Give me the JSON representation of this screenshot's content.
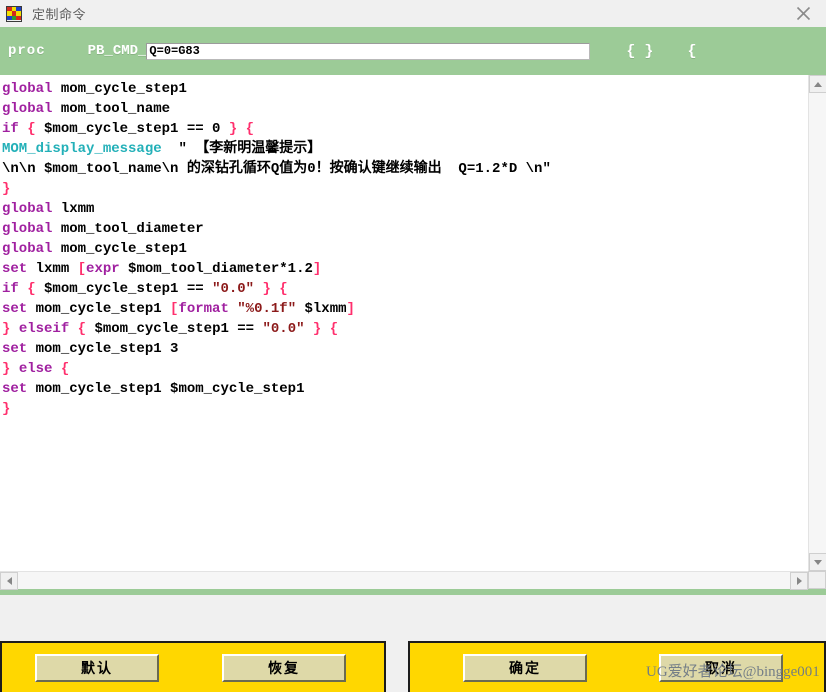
{
  "window": {
    "title": "定制命令",
    "icon": "app-grid-icon",
    "close_label": "×",
    "icon_colors": [
      "#d42a1d",
      "#f2e000",
      "#1f3fc4",
      "#f2e000",
      "#d42a1d",
      "#f2e000",
      "#1f3fc4",
      "#2e9e2e",
      "#d42a1d"
    ]
  },
  "toolbar": {
    "proc_keyword": "proc",
    "name_prefix": "PB_CMD_",
    "proc_name_value": "Q=0=G83",
    "proc_name_placeholder": "",
    "brace_1": "{ }",
    "brace_2": "{",
    "background": "#9ccb97"
  },
  "editor": {
    "lines": [
      [
        {
          "t": "global",
          "c": "kw"
        },
        {
          "t": " mom_cycle_step1",
          "c": "plain"
        }
      ],
      [
        {
          "t": "global",
          "c": "kw"
        },
        {
          "t": " mom_tool_name",
          "c": "plain"
        }
      ],
      [
        {
          "t": "if",
          "c": "kw"
        },
        {
          "t": " ",
          "c": "plain"
        },
        {
          "t": "{",
          "c": "br"
        },
        {
          "t": " $mom_cycle_step1 == 0 ",
          "c": "plain"
        },
        {
          "t": "}",
          "c": "br"
        },
        {
          "t": " ",
          "c": "plain"
        },
        {
          "t": "{",
          "c": "br"
        }
      ],
      [
        {
          "t": "MOM_display_message",
          "c": "cmd"
        },
        {
          "t": "  \" 【李新明温馨提示】",
          "c": "plain"
        }
      ],
      [
        {
          "t": "\\n\\n $mom_tool_name\\n 的深钻孔循环Q值为0！按确认键继续输出  Q=1.2*D \\n\"",
          "c": "plain"
        }
      ],
      [
        {
          "t": "}",
          "c": "br"
        }
      ],
      [
        {
          "t": "global",
          "c": "kw"
        },
        {
          "t": " lxmm",
          "c": "plain"
        }
      ],
      [
        {
          "t": "global",
          "c": "kw"
        },
        {
          "t": " mom_tool_diameter",
          "c": "plain"
        }
      ],
      [
        {
          "t": "global",
          "c": "kw"
        },
        {
          "t": " mom_cycle_step1",
          "c": "plain"
        }
      ],
      [
        {
          "t": "set",
          "c": "kw"
        },
        {
          "t": " lxmm ",
          "c": "plain"
        },
        {
          "t": "[",
          "c": "br"
        },
        {
          "t": "expr",
          "c": "kw"
        },
        {
          "t": " $mom_tool_diameter*1.2",
          "c": "plain"
        },
        {
          "t": "]",
          "c": "br"
        }
      ],
      [
        {
          "t": "if",
          "c": "kw"
        },
        {
          "t": " ",
          "c": "plain"
        },
        {
          "t": "{",
          "c": "br"
        },
        {
          "t": " $mom_cycle_step1 == ",
          "c": "plain"
        },
        {
          "t": "\"0.0\"",
          "c": "str"
        },
        {
          "t": " ",
          "c": "plain"
        },
        {
          "t": "}",
          "c": "br"
        },
        {
          "t": " ",
          "c": "plain"
        },
        {
          "t": "{",
          "c": "br"
        }
      ],
      [
        {
          "t": "set",
          "c": "kw"
        },
        {
          "t": " mom_cycle_step1 ",
          "c": "plain"
        },
        {
          "t": "[",
          "c": "br"
        },
        {
          "t": "format",
          "c": "kw"
        },
        {
          "t": " ",
          "c": "plain"
        },
        {
          "t": "\"%0.1f\"",
          "c": "str"
        },
        {
          "t": " $lxmm",
          "c": "plain"
        },
        {
          "t": "]",
          "c": "br"
        }
      ],
      [
        {
          "t": "}",
          "c": "br"
        },
        {
          "t": " ",
          "c": "plain"
        },
        {
          "t": "elseif",
          "c": "kw"
        },
        {
          "t": " ",
          "c": "plain"
        },
        {
          "t": "{",
          "c": "br"
        },
        {
          "t": " $mom_cycle_step1 == ",
          "c": "plain"
        },
        {
          "t": "\"0.0\"",
          "c": "str"
        },
        {
          "t": " ",
          "c": "plain"
        },
        {
          "t": "}",
          "c": "br"
        },
        {
          "t": " ",
          "c": "plain"
        },
        {
          "t": "{",
          "c": "br"
        }
      ],
      [
        {
          "t": "set",
          "c": "kw"
        },
        {
          "t": " mom_cycle_step1 3",
          "c": "plain"
        }
      ],
      [
        {
          "t": "}",
          "c": "br"
        },
        {
          "t": " ",
          "c": "plain"
        },
        {
          "t": "else",
          "c": "kw"
        },
        {
          "t": " ",
          "c": "plain"
        },
        {
          "t": "{",
          "c": "br"
        }
      ],
      [
        {
          "t": "set",
          "c": "kw"
        },
        {
          "t": " mom_cycle_step1 $mom_cycle_step1",
          "c": "plain"
        }
      ],
      [
        {
          "t": "}",
          "c": "br"
        }
      ]
    ],
    "colors": {
      "keyword": "#a020a0",
      "command": "#23b0b8",
      "brace": "#ff2f6d",
      "string": "#8c1a1a",
      "text": "#000000",
      "background": "#ffffff"
    }
  },
  "scrollbars": {
    "vertical": {
      "up": "scroll-up-arrow",
      "down": "scroll-down-arrow"
    },
    "horizontal": {
      "left": "scroll-left-arrow",
      "right": "scroll-right-arrow"
    }
  },
  "footer": {
    "panel_background": "#ffd700",
    "left_buttons": [
      {
        "label": "默认",
        "name": "default-button"
      },
      {
        "label": "恢复",
        "name": "restore-button"
      }
    ],
    "right_buttons": [
      {
        "label": "确定",
        "name": "ok-button"
      },
      {
        "label": "取消",
        "name": "cancel-button"
      }
    ],
    "watermark": "UG爱好者论坛@bingge001"
  }
}
